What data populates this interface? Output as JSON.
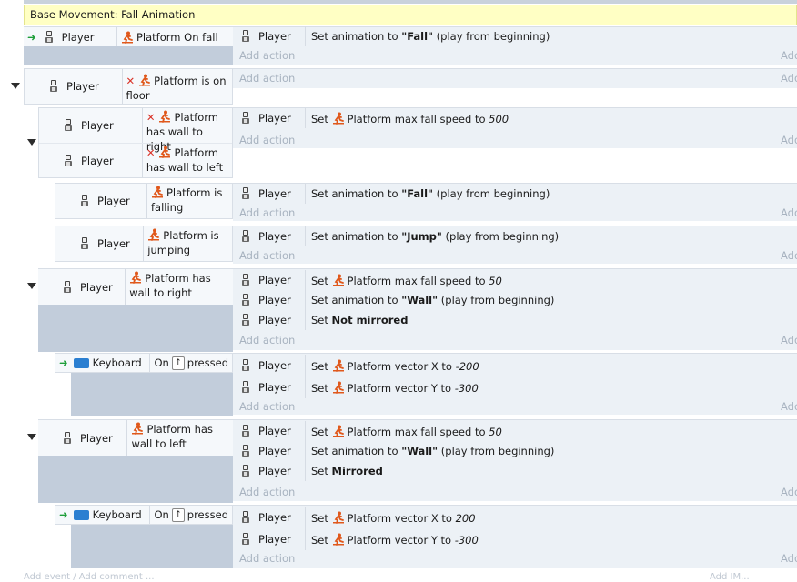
{
  "comment": "Base Movement: Fall Animation",
  "add_action": "Add action",
  "add_short": "Add",
  "bottom_left": "Add event / Add comment ...",
  "bottom_right": "Add IM...",
  "events": {
    "e1": {
      "cond_obj": "Player",
      "cond_text": "Platform On fall",
      "actions": [
        {
          "obj": "Player",
          "pre": "Set animation to ",
          "bold": "\"Fall\"",
          "post": " (play from beginning)"
        }
      ]
    },
    "e2": {
      "cond_obj": "Player",
      "cond_text": "Platform is on floor"
    },
    "e3": {
      "cond_obj_a": "Player",
      "cond_text_a": "Platform has wall to right",
      "cond_obj_b": "Player",
      "cond_text_b": "Platform has wall to left",
      "actions": [
        {
          "obj": "Player",
          "pre": "Set ",
          "plat": "Platform max fall speed to ",
          "ital": "500"
        }
      ]
    },
    "e4": {
      "cond_obj": "Player",
      "cond_text": "Platform is falling",
      "actions": [
        {
          "obj": "Player",
          "pre": "Set animation to ",
          "bold": "\"Fall\"",
          "post": " (play from beginning)"
        }
      ]
    },
    "e5": {
      "cond_obj": "Player",
      "cond_text": "Platform is jumping",
      "actions": [
        {
          "obj": "Player",
          "pre": "Set animation to ",
          "bold": "\"Jump\"",
          "post": " (play from beginning)"
        }
      ]
    },
    "e6": {
      "cond_obj": "Player",
      "cond_text": "Platform has wall to right",
      "actions": [
        {
          "obj": "Player",
          "pre": "Set ",
          "plat": "Platform max fall speed to ",
          "ital": "50"
        },
        {
          "obj": "Player",
          "pre": "Set animation to ",
          "bold": "\"Wall\"",
          "post": " (play from beginning)"
        },
        {
          "obj": "Player",
          "pre": "Set ",
          "bold": "Not mirrored"
        }
      ]
    },
    "e7": {
      "cond_obj": "Keyboard",
      "cond_on": "On",
      "cond_key": "↑",
      "cond_post": "pressed",
      "actions": [
        {
          "obj": "Player",
          "pre": "Set ",
          "plat": "Platform vector X to ",
          "ital": "-200"
        },
        {
          "obj": "Player",
          "pre": "Set ",
          "plat": "Platform vector Y to ",
          "ital": "-300"
        }
      ]
    },
    "e8": {
      "cond_obj": "Player",
      "cond_text": "Platform has wall to left",
      "actions": [
        {
          "obj": "Player",
          "pre": "Set ",
          "plat": "Platform max fall speed to ",
          "ital": "50"
        },
        {
          "obj": "Player",
          "pre": "Set animation to ",
          "bold": "\"Wall\"",
          "post": " (play from beginning)"
        },
        {
          "obj": "Player",
          "pre": "Set ",
          "bold": "Mirrored"
        }
      ]
    },
    "e9": {
      "cond_obj": "Keyboard",
      "cond_on": "On",
      "cond_key": "↑",
      "cond_post": "pressed",
      "actions": [
        {
          "obj": "Player",
          "pre": "Set ",
          "plat": "Platform vector X to ",
          "ital": "200"
        },
        {
          "obj": "Player",
          "pre": "Set ",
          "plat": "Platform vector Y to ",
          "ital": "-300"
        }
      ]
    }
  }
}
